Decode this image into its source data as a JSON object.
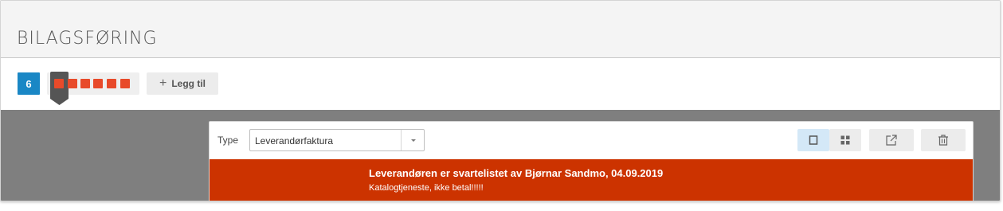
{
  "header": {
    "title": "BILAGSFØRING"
  },
  "toolbar": {
    "count": "6",
    "voucher_count": 6,
    "add_label": "Legg til",
    "accent": "#1a87c5",
    "voucher_color": "#e84a2a"
  },
  "panel": {
    "type_label": "Type",
    "type_value": "Leverandørfaktura",
    "buttons": [
      "square-icon",
      "grid-icon",
      "external-link-icon",
      "trash-icon"
    ]
  },
  "alert": {
    "title": "Leverandøren er svartelistet av Bjørnar Sandmo, 04.09.2019",
    "text": "Katalogtjeneste, ikke betal!!!!!",
    "color": "#cc3300"
  }
}
